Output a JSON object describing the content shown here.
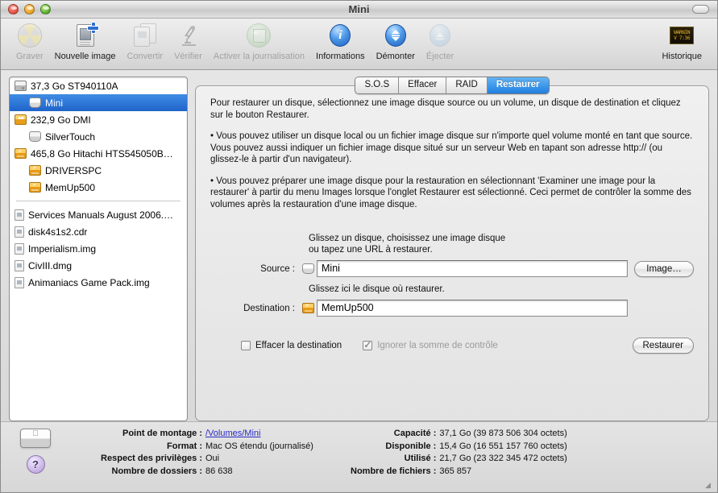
{
  "window": {
    "title": "Mini"
  },
  "toolbar": {
    "items": [
      {
        "label": "Graver",
        "icon": "burn-icon",
        "enabled": false
      },
      {
        "label": "Nouvelle image",
        "icon": "new-image-icon",
        "enabled": true
      },
      {
        "label": "Convertir",
        "icon": "convert-icon",
        "enabled": false
      },
      {
        "label": "Vérifier",
        "icon": "verify-icon",
        "enabled": false
      },
      {
        "label": "Activer la journalisation",
        "icon": "journaling-icon",
        "enabled": false
      },
      {
        "label": "Informations",
        "icon": "info-icon",
        "enabled": true
      },
      {
        "label": "Démonter",
        "icon": "unmount-icon",
        "enabled": true
      },
      {
        "label": "Éjecter",
        "icon": "eject-icon",
        "enabled": false
      }
    ],
    "history": {
      "label": "Historique",
      "icon": "history-icon",
      "thumb_line1": "WARNIN",
      "thumb_line2": "V 7:36"
    }
  },
  "sidebar": {
    "devices": [
      {
        "label": "37,3 Go ST940110A",
        "icon": "internal-hdd-icon",
        "indent": false,
        "selected": false
      },
      {
        "label": "Mini",
        "icon": "volume-icon",
        "indent": true,
        "selected": true
      },
      {
        "label": "232,9 Go DMI",
        "icon": "firewire-hdd-icon",
        "indent": false,
        "selected": false
      },
      {
        "label": "SilverTouch",
        "icon": "volume-icon-grey",
        "indent": true,
        "selected": false
      },
      {
        "label": "465,8 Go Hitachi HTS545050B…",
        "icon": "usb-hdd-icon",
        "indent": false,
        "selected": false
      },
      {
        "label": "DRIVERSPC",
        "icon": "usb-volume-icon",
        "indent": true,
        "selected": false
      },
      {
        "label": "MemUp500",
        "icon": "usb-volume-icon",
        "indent": true,
        "selected": false
      }
    ],
    "images": [
      {
        "label": "Services Manuals August 2006.…",
        "icon": "disk-image-icon"
      },
      {
        "label": "disk4s1s2.cdr",
        "icon": "disk-image-icon"
      },
      {
        "label": "Imperialism.img",
        "icon": "disk-image-icon"
      },
      {
        "label": "CivIII.dmg",
        "icon": "disk-image-icon"
      },
      {
        "label": "Animaniacs Game Pack.img",
        "icon": "disk-image-icon"
      }
    ]
  },
  "tabs": [
    {
      "label": "S.O.S",
      "active": false
    },
    {
      "label": "Effacer",
      "active": false
    },
    {
      "label": "RAID",
      "active": false
    },
    {
      "label": "Restaurer",
      "active": true
    }
  ],
  "restore": {
    "intro": "Pour restaurer un disque, sélectionnez une image disque source ou un volume, un disque de destination et cliquez sur le bouton Restaurer.",
    "bullet1": "• Vous pouvez utiliser un disque local ou un fichier image disque sur n'importe quel volume monté en tant que source. Vous pouvez aussi indiquer un fichier image disque situé sur un serveur Web en tapant son adresse http:// (ou glissez-le à partir d'un navigateur).",
    "bullet2": "• Vous pouvez préparer une image disque pour la restauration en sélectionnant 'Examiner une image pour la restaurer' à partir du menu Images lorsque l'onglet Restaurer est sélectionné. Ceci permet de contrôler la somme des volumes après la restauration d'une image disque.",
    "source_hint_line1": "Glissez un disque, choisissez une image disque",
    "source_hint_line2": "ou tapez une URL à restaurer.",
    "source_label": "Source :",
    "source_value": "Mini",
    "source_icon": "volume-icon",
    "image_button": "Image…",
    "destination_hint": "Glissez ici le disque où restaurer.",
    "destination_label": "Destination :",
    "destination_value": "MemUp500",
    "destination_icon": "usb-volume-icon",
    "erase_destination_label": "Effacer la destination",
    "erase_destination_checked": false,
    "ignore_checksum_label": "Ignorer la somme de contrôle",
    "ignore_checksum_checked": true,
    "ignore_checksum_disabled": true,
    "restore_button": "Restaurer"
  },
  "status": {
    "left": [
      {
        "key": "Point de montage :",
        "value": "/Volumes/Mini",
        "is_link": true
      },
      {
        "key": "Format :",
        "value": "Mac OS étendu (journalisé)",
        "is_link": false
      },
      {
        "key": "Respect des privilèges :",
        "value": "Oui",
        "is_link": false
      },
      {
        "key": "Nombre de dossiers :",
        "value": "86 638",
        "is_link": false
      }
    ],
    "right": [
      {
        "key": "Capacité :",
        "value": "37,1 Go (39 873 506 304 octets)"
      },
      {
        "key": "Disponible :",
        "value": "15,4 Go (16 551 157 760 octets)"
      },
      {
        "key": "Utilisé :",
        "value": "21,7 Go (23 322 345 472 octets)"
      },
      {
        "key": "Nombre de fichiers :",
        "value": "365 857"
      }
    ],
    "device_icon": "mac-mini-icon",
    "help_label": "?"
  }
}
